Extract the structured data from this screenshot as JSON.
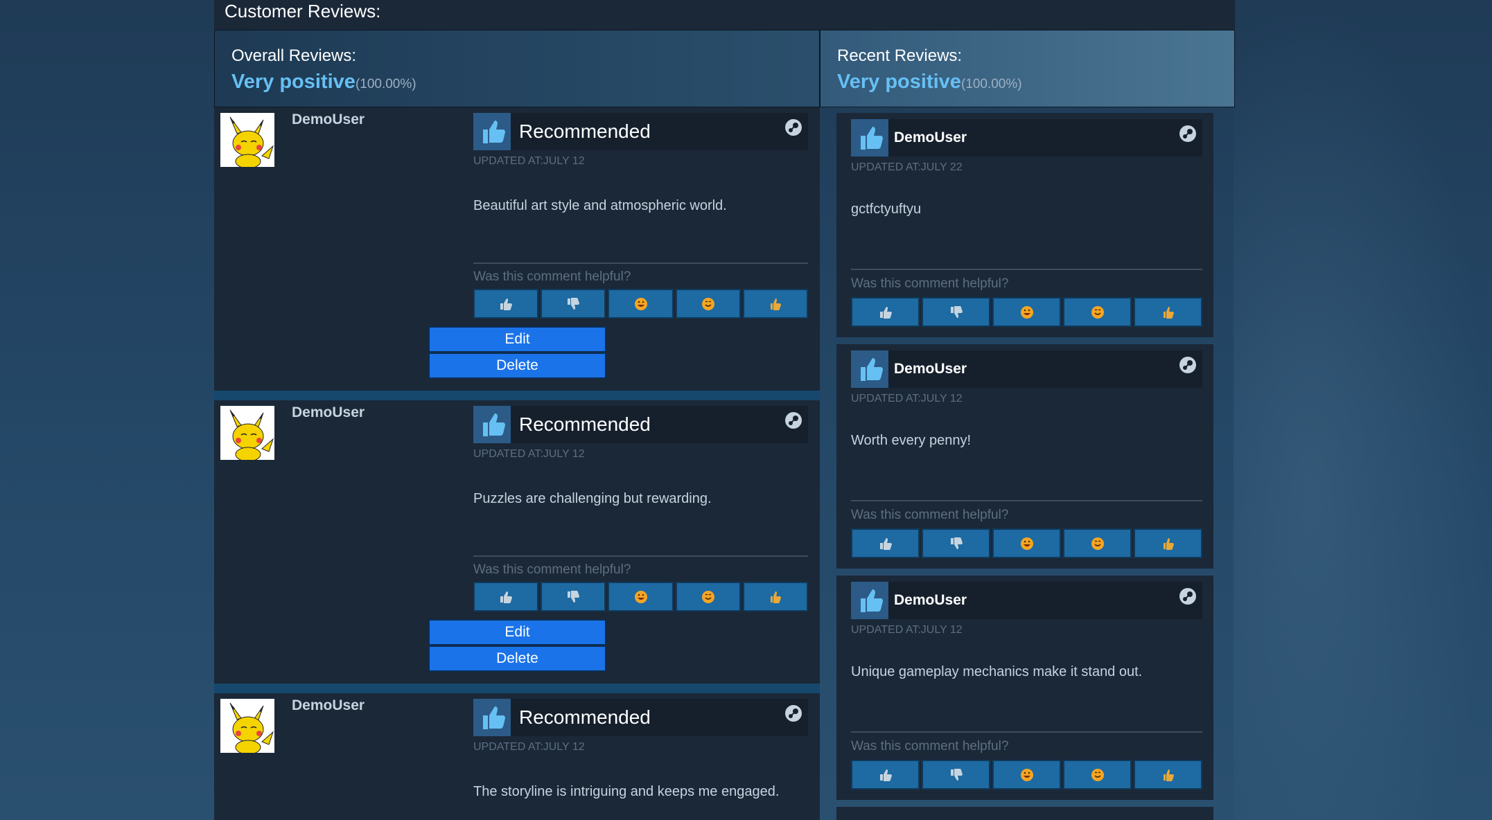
{
  "header": {
    "title": "Customer Reviews:"
  },
  "overall": {
    "label": "Overall Reviews:",
    "rating": "Very positive",
    "percent": "(100.00%)"
  },
  "recent": {
    "label": "Recent Reviews:",
    "rating": "Very positive",
    "percent": "(100.00%)"
  },
  "colors": {
    "accent": "#66c0f4",
    "vote_button": "#1e6aa3",
    "action_button": "#1a73e8",
    "panel": "#1b2838"
  },
  "helpful_label": "Was this comment helpful?",
  "vote_icons": [
    "thumbs-up-icon",
    "thumbs-down-icon",
    "laugh-emoji-icon",
    "smile-emoji-icon",
    "award-thumb-icon"
  ],
  "left_reviews": [
    {
      "username": "DemoUser",
      "recommendation": "Recommended",
      "updated": "UPDATED AT:JULY 12",
      "text": "Beautiful art style and atmospheric world.",
      "edit_label": "Edit",
      "delete_label": "Delete"
    },
    {
      "username": "DemoUser",
      "recommendation": "Recommended",
      "updated": "UPDATED AT:JULY 12",
      "text": "Puzzles are challenging but rewarding.",
      "edit_label": "Edit",
      "delete_label": "Delete"
    },
    {
      "username": "DemoUser",
      "recommendation": "Recommended",
      "updated": "UPDATED AT:JULY 12",
      "text": "The storyline is intriguing and keeps me engaged."
    }
  ],
  "right_reviews": [
    {
      "username": "DemoUser",
      "updated": "UPDATED AT:JULY 22",
      "text": "gctfctyuftyu"
    },
    {
      "username": "DemoUser",
      "updated": "UPDATED AT:JULY 12",
      "text": "Worth every penny!"
    },
    {
      "username": "DemoUser",
      "updated": "UPDATED AT:JULY 12",
      "text": "Unique gameplay mechanics make it stand out."
    }
  ]
}
